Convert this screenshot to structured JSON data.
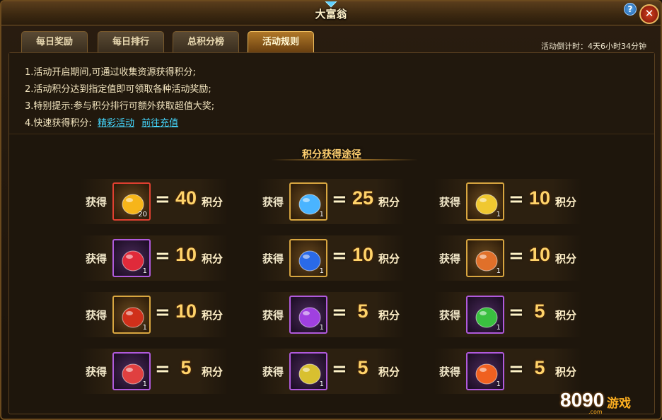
{
  "window": {
    "title": "大富翁"
  },
  "tabs": [
    {
      "label": "每日奖励",
      "active": false
    },
    {
      "label": "每日排行",
      "active": false
    },
    {
      "label": "总积分榜",
      "active": false
    },
    {
      "label": "活动规则",
      "active": true
    }
  ],
  "countdown": "活动倒计时：4天6小时34分钟",
  "rules": {
    "r1": "1.活动开启期间,可通过收集资源获得积分;",
    "r2": "2.活动积分达到指定值即可领取各种活动奖励;",
    "r3": "3.特别提示:参与积分排行可额外获取超值大奖;",
    "r4_prefix": "4.快速获得积分:",
    "link1": "精彩活动",
    "link2": "前往充值"
  },
  "section_title": "积分获得途径",
  "reward_label": "获得",
  "reward_unit": "积分",
  "rewards": [
    {
      "icon": "gold-gem-icon",
      "qty": "20",
      "points": "40",
      "color": "#f6b51a"
    },
    {
      "icon": "blue-crystal-icon",
      "qty": "1",
      "points": "25",
      "color": "#4ab4ff"
    },
    {
      "icon": "gold-orb-icon",
      "qty": "1",
      "points": "10",
      "color": "#f0c830"
    },
    {
      "icon": "red-orb-icon",
      "qty": "1",
      "points": "10",
      "color": "#e02a3a"
    },
    {
      "icon": "blue-swirl-icon",
      "qty": "1",
      "points": "10",
      "color": "#2a6ae8"
    },
    {
      "icon": "orange-rune-icon",
      "qty": "1",
      "points": "10",
      "color": "#e0702a"
    },
    {
      "icon": "red-rune-icon",
      "qty": "1",
      "points": "10",
      "color": "#d0301a"
    },
    {
      "icon": "purple-orb-icon",
      "qty": "1",
      "points": "5",
      "color": "#a040e0"
    },
    {
      "icon": "green-stone-icon",
      "qty": "1",
      "points": "5",
      "color": "#3ac040"
    },
    {
      "icon": "red-crystal-icon",
      "qty": "1",
      "points": "5",
      "color": "#e04040"
    },
    {
      "icon": "yellow-stone-icon",
      "qty": "1",
      "points": "5",
      "color": "#d8c030"
    },
    {
      "icon": "fire-orb-icon",
      "qty": "1",
      "points": "5",
      "color": "#f06020"
    }
  ],
  "watermark": {
    "num": "8090",
    "cn": "游戏",
    "domain": ".com"
  }
}
